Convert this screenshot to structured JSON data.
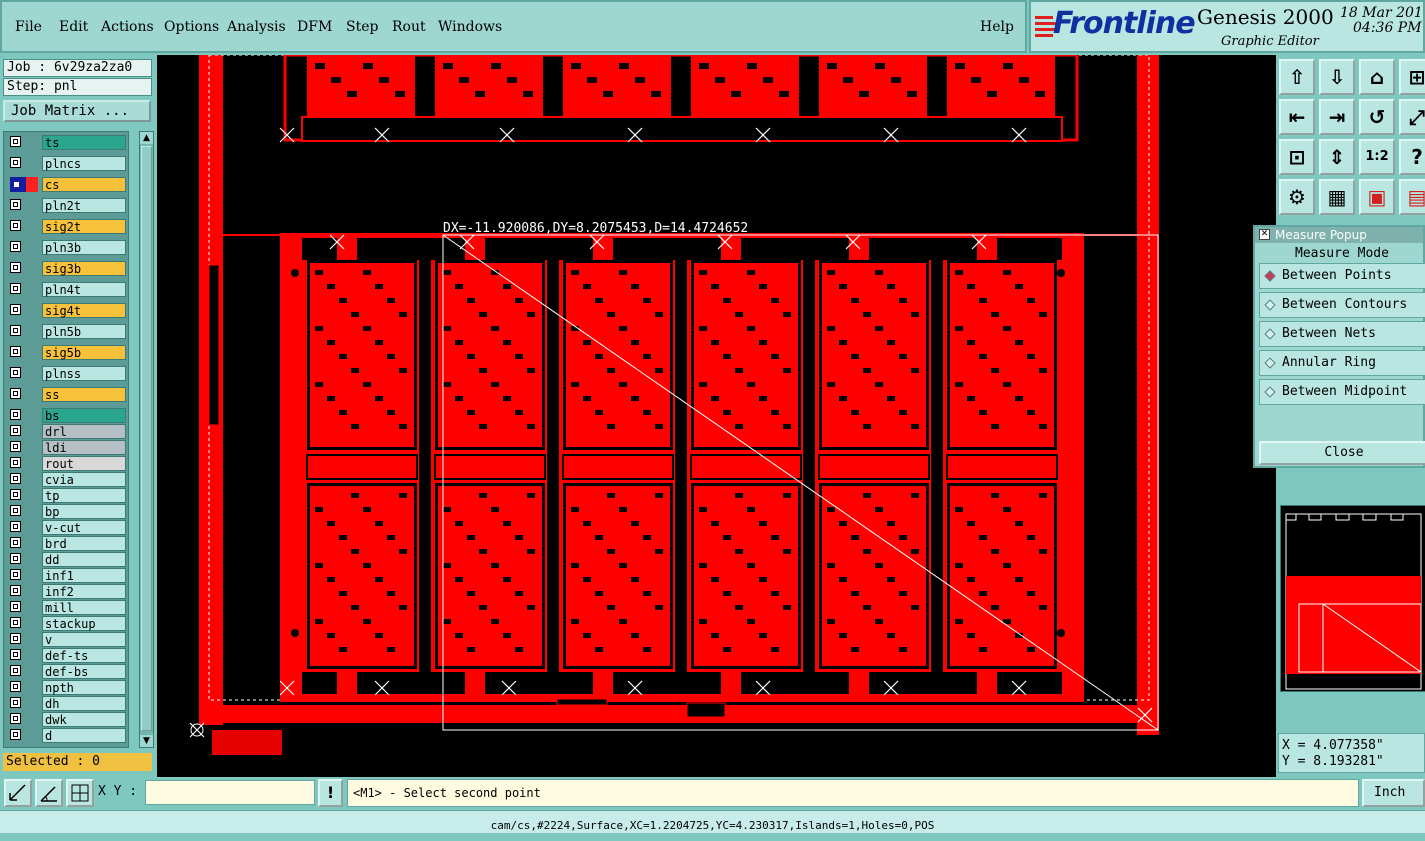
{
  "menu": {
    "file": "File",
    "edit": "Edit",
    "actions": "Actions",
    "options": "Options",
    "analysis": "Analysis",
    "dfm": "DFM",
    "step": "Step",
    "rout": "Rout",
    "windows": "Windows",
    "help": "Help"
  },
  "brand": {
    "logo": "Frontline",
    "product": "Genesis 2000",
    "subtitle": "Graphic Editor",
    "date": "18 Mar 201",
    "time": "04:36 PM"
  },
  "job": {
    "job_label": "Job : 6v29za2za0",
    "step_label": "Step: pnl",
    "matrix_button": "Job Matrix ..."
  },
  "layers": [
    {
      "name": "ts",
      "color": "#2aa58e"
    },
    {
      "name": "plncs",
      "color": "#b9e6e1"
    },
    {
      "name": "cs",
      "color": "#f7c23a",
      "active": true
    },
    {
      "name": "pln2t",
      "color": "#b9e6e1"
    },
    {
      "name": "sig2t",
      "color": "#f7c23a"
    },
    {
      "name": "pln3b",
      "color": "#b9e6e1"
    },
    {
      "name": "sig3b",
      "color": "#f7c23a"
    },
    {
      "name": "pln4t",
      "color": "#b9e6e1"
    },
    {
      "name": "sig4t",
      "color": "#f7c23a"
    },
    {
      "name": "pln5b",
      "color": "#b9e6e1"
    },
    {
      "name": "sig5b",
      "color": "#f7c23a"
    },
    {
      "name": "plnss",
      "color": "#b9e6e1"
    },
    {
      "name": "ss",
      "color": "#f7c23a"
    },
    {
      "name": "bs",
      "color": "#2aa58e"
    },
    {
      "name": "drl",
      "color": "#b6c0c4"
    },
    {
      "name": "ldi",
      "color": "#b6c0c4"
    },
    {
      "name": "rout",
      "color": "#d8d8d8"
    },
    {
      "name": "cvia",
      "color": "#b9e6e1"
    },
    {
      "name": "tp",
      "color": "#b9e6e1"
    },
    {
      "name": "bp",
      "color": "#b9e6e1"
    },
    {
      "name": "v-cut",
      "color": "#b9e6e1"
    },
    {
      "name": "brd",
      "color": "#b9e6e1"
    },
    {
      "name": "dd",
      "color": "#b9e6e1"
    },
    {
      "name": "inf1",
      "color": "#b9e6e1"
    },
    {
      "name": "inf2",
      "color": "#b9e6e1"
    },
    {
      "name": "mill",
      "color": "#b9e6e1"
    },
    {
      "name": "stackup",
      "color": "#b9e6e1"
    },
    {
      "name": "v",
      "color": "#b9e6e1"
    },
    {
      "name": "def-ts",
      "color": "#b9e6e1"
    },
    {
      "name": "def-bs",
      "color": "#b9e6e1"
    },
    {
      "name": "npth",
      "color": "#b9e6e1"
    },
    {
      "name": "dh",
      "color": "#b9e6e1"
    },
    {
      "name": "dwk",
      "color": "#b9e6e1"
    },
    {
      "name": "d",
      "color": "#b9e6e1"
    }
  ],
  "selected": "Selected : 0",
  "measure_readout": "DX=-11.920086,DY=8.2075453,D=14.4724652",
  "measure_popup": {
    "title": "Measure Popup",
    "mode_label": "Measure Mode",
    "modes": [
      "Between Points",
      "Between Contours",
      "Between Nets",
      "Annular Ring",
      "Between Midpoint"
    ],
    "close": "Close"
  },
  "coords": {
    "x": "X = 4.077358\"",
    "y": "Y = 8.193281\""
  },
  "toolbar_icons": [
    "zoom-home-icon",
    "zoom-out-icon",
    "house-icon",
    "fit-icon",
    "pan-left-icon",
    "pan-right-icon",
    "swap-icon",
    "expand-icon",
    "fit-screen-icon",
    "fit-profile-icon",
    "ratio-icon",
    "help-icon",
    "settings-icon",
    "grid-icon",
    "layers-icon",
    "layers2-icon"
  ],
  "bottom": {
    "xy_label": "X Y :",
    "xy_value": "",
    "prompt": "<M1> - Select second point",
    "unit": "Inch"
  },
  "status": "cam/cs,#2224,Surface,XC=1.2204725,YC=4.230317,Islands=1,Holes=0,POS",
  "colors": {
    "copper": "#ff0000",
    "background": "#000000",
    "panel": "#7fc8c0"
  }
}
